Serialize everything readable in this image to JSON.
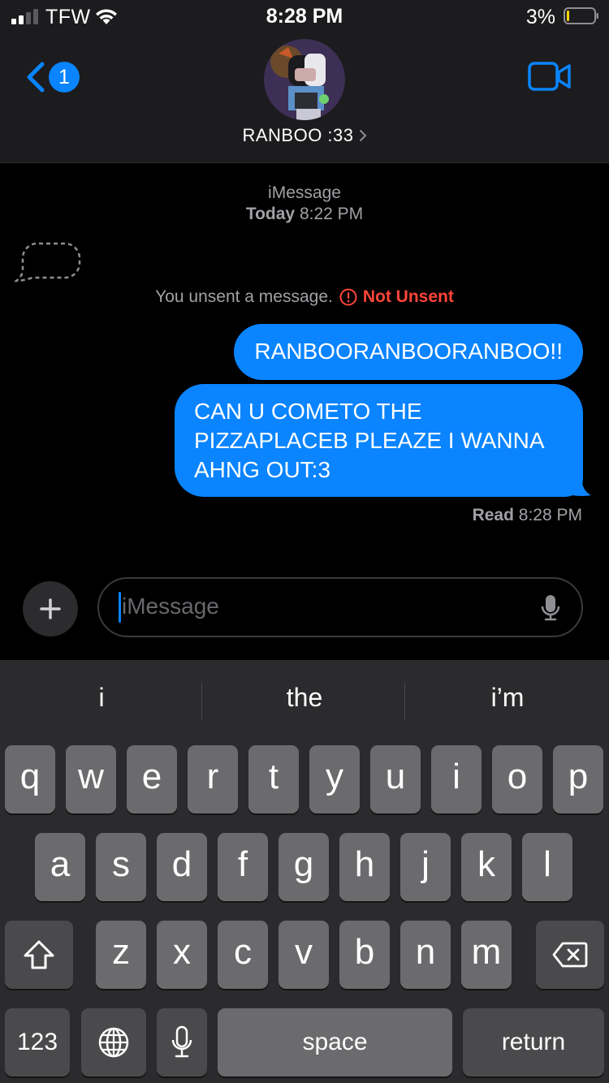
{
  "status_bar": {
    "carrier": "TFW",
    "time": "8:28 PM",
    "battery_percent": "3%",
    "signal_bars_filled": 2,
    "signal_bars_total": 4,
    "battery_level_fraction": 0.03
  },
  "header": {
    "back_badge_count": "1",
    "contact_name": "RANBOO :33",
    "chevron": "›"
  },
  "thread": {
    "service_label": "iMessage",
    "timestamp_day": "Today",
    "timestamp_time": "8:22 PM",
    "unsent_notice": "You unsent a message.",
    "not_unsent_label": "Not Unsent",
    "messages": [
      {
        "direction": "outgoing",
        "text": "RANBOORANBOORANBOO!!"
      },
      {
        "direction": "outgoing",
        "text": "CAN U COMETO THE PIZZAPLACEB PLEAZE I WANNA AHNG OUT:3"
      }
    ],
    "read_receipt_label": "Read",
    "read_receipt_time": "8:28 PM"
  },
  "compose": {
    "placeholder": "iMessage"
  },
  "keyboard": {
    "suggestions": [
      "i",
      "the",
      "i’m"
    ],
    "row1": [
      "q",
      "w",
      "e",
      "r",
      "t",
      "y",
      "u",
      "i",
      "o",
      "p"
    ],
    "row2": [
      "a",
      "s",
      "d",
      "f",
      "g",
      "h",
      "j",
      "k",
      "l"
    ],
    "row3": [
      "z",
      "x",
      "c",
      "v",
      "b",
      "n",
      "m"
    ],
    "numbers_key": "123",
    "space_key": "space",
    "return_key": "return"
  },
  "colors": {
    "accent_blue": "#0a84ff",
    "alert_red": "#ff453a",
    "header_background": "#1c1c1e",
    "keyboard_background": "#2b2b2d",
    "key_background": "#6b6b6e"
  }
}
